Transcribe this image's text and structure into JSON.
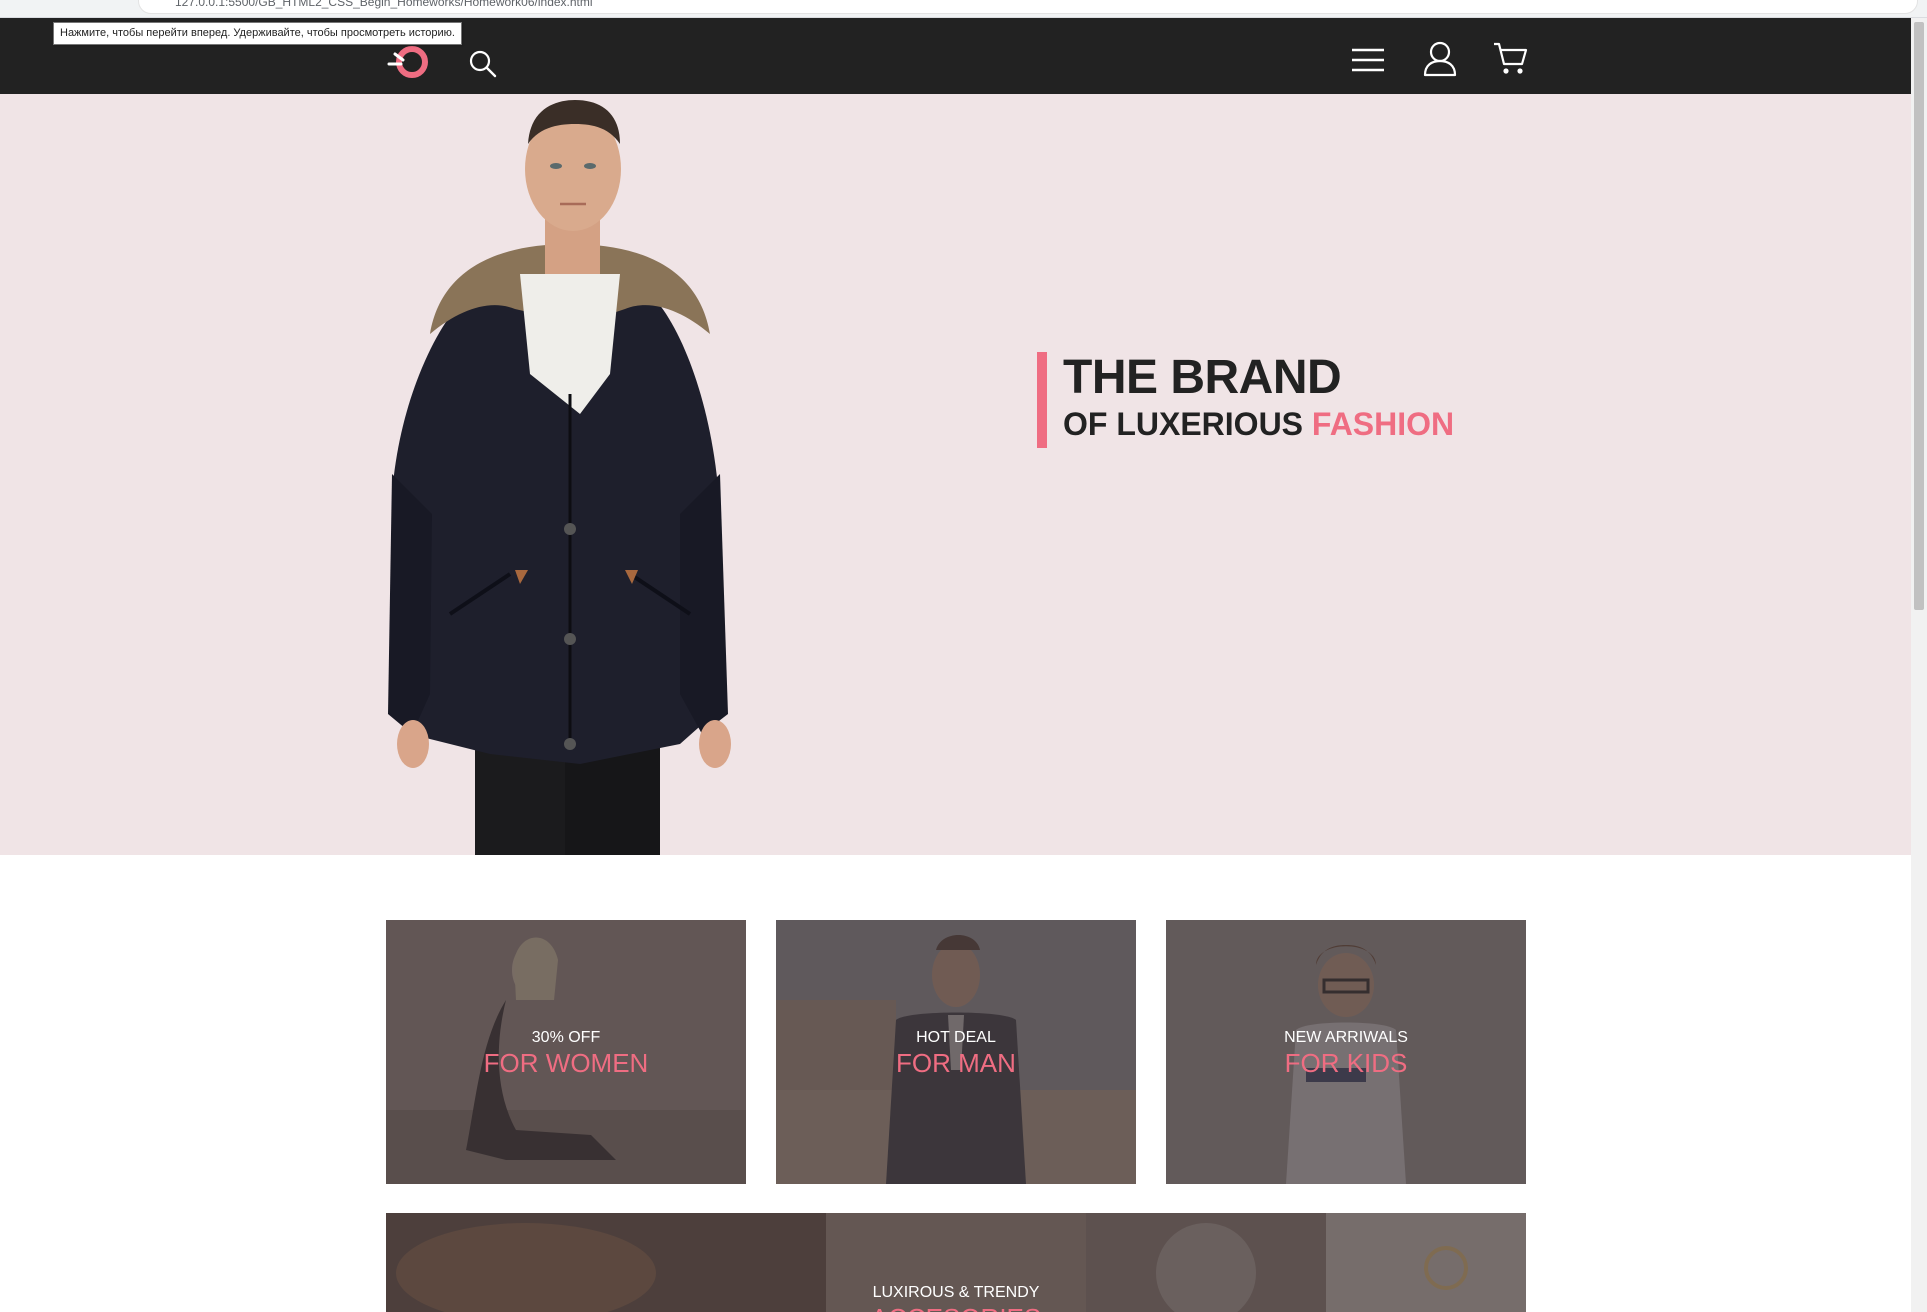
{
  "browser": {
    "url": "127.0.0.1:5500/GB_HTML2_CSS_Begin_Homeworks/Homework06/index.html",
    "tooltip": "Нажмите, чтобы перейти вперед. Удерживайте, чтобы просмотреть историю."
  },
  "header": {
    "logo_icon": "brand-logo-icon",
    "search_icon": "search-icon",
    "menu_icon": "hamburger-menu-icon",
    "user_icon": "user-account-icon",
    "cart_icon": "shopping-cart-icon"
  },
  "hero": {
    "title": "THE BRAND",
    "subtitle_plain": "OF LUXERIOUS ",
    "subtitle_accent": "FASHION"
  },
  "categories": [
    {
      "kicker": "30% OFF",
      "title": "FOR WOMEN"
    },
    {
      "kicker": "HOT DEAL",
      "title": "FOR MAN"
    },
    {
      "kicker": "NEW ARRIWALS",
      "title": "FOR KIDS"
    }
  ],
  "wide_category": {
    "kicker": "LUXIROUS & TRENDY",
    "title": "ACCESORIES"
  },
  "colors": {
    "accent": "#ef6d82",
    "header_bg": "#222222",
    "hero_bg": "#f0e4e6",
    "text_dark": "#222222"
  }
}
